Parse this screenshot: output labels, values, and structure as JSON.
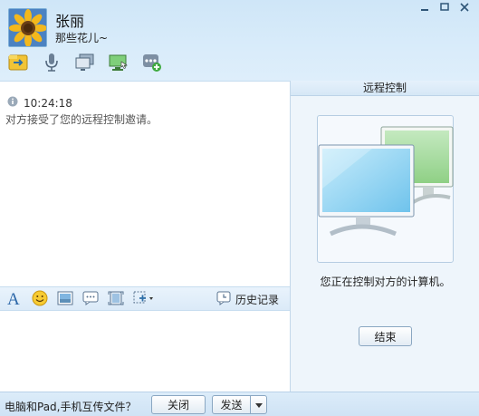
{
  "header": {
    "name": "张丽",
    "signature": "那些花儿~"
  },
  "window_buttons": [
    "minimize-icon",
    "maximize-icon",
    "close-icon"
  ],
  "toolbar": {
    "items": [
      "file-transfer-icon",
      "voice-call-icon",
      "screen-share-icon",
      "remote-assist-icon",
      "more-apps-icon"
    ]
  },
  "chat": {
    "system_time": "10:24:18",
    "system_message": "对方接受了您的远程控制邀请。"
  },
  "format_toolbar": {
    "items": [
      "font-icon",
      "emoji-icon",
      "image-icon",
      "shake-icon",
      "screenshot-icon",
      "capture-dropdown-icon"
    ],
    "history_label": "历史记录"
  },
  "remote_panel": {
    "title": "远程控制",
    "status": "您正在控制对方的计算机。",
    "end_button": "结束",
    "colors": {
      "front_screen": "#8fd0f2",
      "back_screen": "#9fdc96"
    }
  },
  "bottom": {
    "info_text": "电脑和Pad,手机互传文件？",
    "close_button": "关闭",
    "send_button": "发送"
  }
}
